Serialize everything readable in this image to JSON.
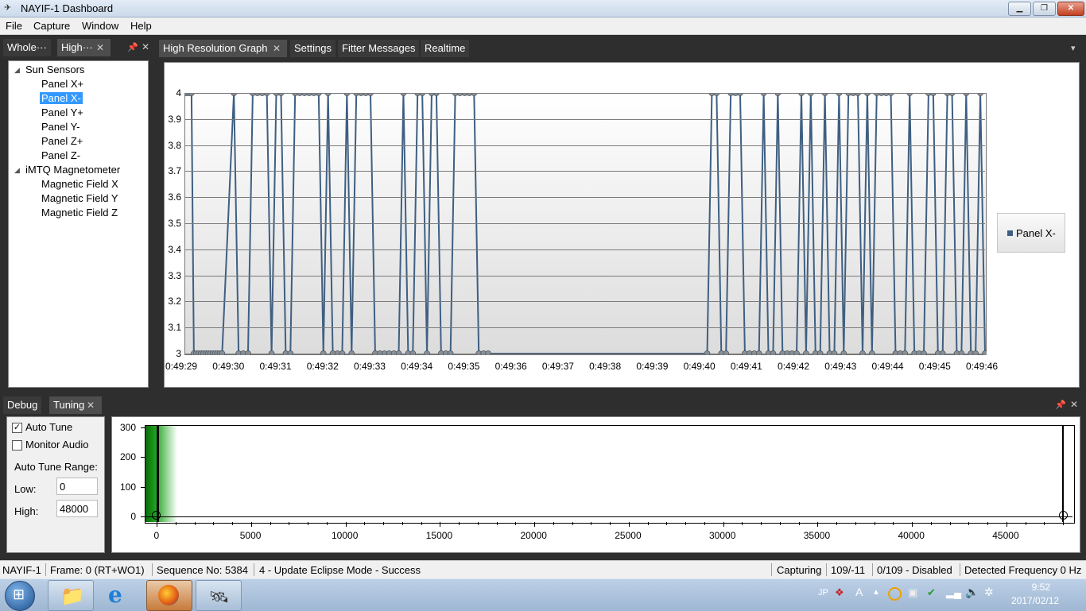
{
  "window": {
    "title": "NAYIF-1 Dashboard"
  },
  "menu": [
    "File",
    "Capture",
    "Window",
    "Help"
  ],
  "left_panel": {
    "tabs": [
      "Whole···",
      "High···"
    ],
    "tree": [
      {
        "label": "Sun Sensors",
        "children": [
          "Panel X+",
          "Panel X-",
          "Panel Y+",
          "Panel Y-",
          "Panel Z+",
          "Panel Z-"
        ]
      },
      {
        "label": "iMTQ Magnetometer",
        "children": [
          "Magnetic Field X",
          "Magnetic Field Y",
          "Magnetic Field Z"
        ]
      }
    ],
    "selected": "Panel X-"
  },
  "main_tabs": [
    "High Resolution Graph",
    "Settings",
    "Fitter Messages",
    "Realtime"
  ],
  "chart_data": {
    "type": "line",
    "series": [
      {
        "name": "Panel X-",
        "color": "#3e5f82"
      }
    ],
    "y_ticks": [
      "4",
      "3.9",
      "3.8",
      "3.7",
      "3.6",
      "3.5",
      "3.4",
      "3.3",
      "3.2",
      "3.1",
      "3"
    ],
    "ylim": [
      3,
      4
    ],
    "x_ticks": [
      "0:49:29",
      "0:49:30",
      "0:49:31",
      "0:49:32",
      "0:49:33",
      "0:49:34",
      "0:49:35",
      "0:49:36",
      "0:49:37",
      "0:49:38",
      "0:49:39",
      "0:49:40",
      "0:49:41",
      "0:49:42",
      "0:49:43",
      "0:49:44",
      "0:49:45",
      "0:49:46"
    ],
    "points": [
      [
        0.0,
        4
      ],
      [
        0.05,
        4
      ],
      [
        0.1,
        4
      ],
      [
        0.15,
        4
      ],
      [
        0.2,
        3
      ],
      [
        0.25,
        3
      ],
      [
        0.3,
        3
      ],
      [
        0.35,
        3
      ],
      [
        0.4,
        3
      ],
      [
        0.45,
        3
      ],
      [
        0.5,
        3
      ],
      [
        0.55,
        3
      ],
      [
        0.6,
        3
      ],
      [
        0.65,
        3
      ],
      [
        0.7,
        3
      ],
      [
        0.75,
        3
      ],
      [
        0.8,
        3
      ],
      [
        1.05,
        4
      ],
      [
        1.15,
        3
      ],
      [
        1.25,
        3
      ],
      [
        1.35,
        3
      ],
      [
        1.45,
        4
      ],
      [
        1.55,
        4
      ],
      [
        1.65,
        4
      ],
      [
        1.75,
        4
      ],
      [
        1.85,
        3
      ],
      [
        1.95,
        4
      ],
      [
        2.05,
        4
      ],
      [
        2.15,
        3
      ],
      [
        2.25,
        3
      ],
      [
        2.35,
        4
      ],
      [
        2.45,
        4
      ],
      [
        2.55,
        4
      ],
      [
        2.65,
        4
      ],
      [
        2.75,
        4
      ],
      [
        2.85,
        4
      ],
      [
        2.95,
        3
      ],
      [
        3.05,
        4
      ],
      [
        3.15,
        3
      ],
      [
        3.25,
        3
      ],
      [
        3.35,
        3
      ],
      [
        3.45,
        4
      ],
      [
        3.55,
        3
      ],
      [
        3.65,
        4
      ],
      [
        3.75,
        4
      ],
      [
        3.85,
        4
      ],
      [
        3.95,
        4
      ],
      [
        4.05,
        3
      ],
      [
        4.15,
        3
      ],
      [
        4.25,
        3
      ],
      [
        4.35,
        3
      ],
      [
        4.45,
        3
      ],
      [
        4.55,
        3
      ],
      [
        4.65,
        4
      ],
      [
        4.75,
        3
      ],
      [
        4.85,
        3
      ],
      [
        4.95,
        4
      ],
      [
        5.05,
        4
      ],
      [
        5.15,
        3
      ],
      [
        5.25,
        4
      ],
      [
        5.35,
        4
      ],
      [
        5.45,
        3
      ],
      [
        5.55,
        3
      ],
      [
        5.65,
        3
      ],
      [
        5.75,
        4
      ],
      [
        5.85,
        4
      ],
      [
        5.95,
        4
      ],
      [
        6.05,
        4
      ],
      [
        6.15,
        4
      ],
      [
        6.25,
        3
      ],
      [
        6.35,
        3
      ],
      [
        6.45,
        3
      ],
      [
        11.1,
        3
      ],
      [
        11.2,
        4
      ],
      [
        11.3,
        4
      ],
      [
        11.4,
        3
      ],
      [
        11.5,
        3
      ],
      [
        11.6,
        4
      ],
      [
        11.7,
        4
      ],
      [
        11.8,
        4
      ],
      [
        11.9,
        3
      ],
      [
        12.0,
        3
      ],
      [
        12.1,
        3
      ],
      [
        12.2,
        3
      ],
      [
        12.3,
        4
      ],
      [
        12.4,
        3
      ],
      [
        12.5,
        3
      ],
      [
        12.6,
        4
      ],
      [
        12.7,
        3
      ],
      [
        12.8,
        3
      ],
      [
        12.9,
        3
      ],
      [
        13.0,
        3
      ],
      [
        13.1,
        4
      ],
      [
        13.2,
        3
      ],
      [
        13.3,
        4
      ],
      [
        13.4,
        3
      ],
      [
        13.5,
        3
      ],
      [
        13.6,
        4
      ],
      [
        13.7,
        3
      ],
      [
        13.8,
        3
      ],
      [
        13.9,
        4
      ],
      [
        14.0,
        3
      ],
      [
        14.1,
        4
      ],
      [
        14.2,
        4
      ],
      [
        14.3,
        4
      ],
      [
        14.4,
        3
      ],
      [
        14.5,
        4
      ],
      [
        14.6,
        3
      ],
      [
        14.7,
        4
      ],
      [
        14.8,
        4
      ],
      [
        14.9,
        4
      ],
      [
        15.0,
        4
      ],
      [
        15.1,
        3
      ],
      [
        15.2,
        3
      ],
      [
        15.3,
        3
      ],
      [
        15.4,
        4
      ],
      [
        15.5,
        3
      ],
      [
        15.6,
        3
      ],
      [
        15.7,
        3
      ],
      [
        15.8,
        4
      ],
      [
        15.9,
        4
      ],
      [
        16.0,
        3
      ],
      [
        16.1,
        3
      ],
      [
        16.2,
        4
      ],
      [
        16.3,
        4
      ],
      [
        16.4,
        3
      ],
      [
        16.5,
        3
      ],
      [
        16.6,
        4
      ],
      [
        16.7,
        3
      ],
      [
        16.8,
        3
      ],
      [
        16.9,
        4
      ],
      [
        17.0,
        3
      ]
    ],
    "x_range": [
      0,
      17
    ],
    "legend": "right"
  },
  "bottom_panel": {
    "tabs": [
      "Debug",
      "Tuning"
    ],
    "auto_tune_label": "Auto Tune",
    "auto_tune_checked": true,
    "monitor_audio_label": "Monitor Audio",
    "monitor_audio_checked": false,
    "range_label": "Auto Tune Range:",
    "low_label": "Low:",
    "low_value": "0",
    "high_label": "High:",
    "high_value": "48000",
    "spectrum": {
      "y_ticks": [
        "300",
        "200",
        "100",
        "0"
      ],
      "x_ticks": [
        "0",
        "5000",
        "10000",
        "15000",
        "20000",
        "25000",
        "30000",
        "35000",
        "40000",
        "45000"
      ],
      "x_max": 48000
    }
  },
  "status": {
    "sat": "NAYIF-1",
    "frame": "Frame:  0 (RT+WO1)",
    "sequence": "Sequence No:  5384",
    "message": "4 - Update Eclipse Mode - Success",
    "capturing": "Capturing",
    "count1": "109/-11",
    "count2": "0/109 - Disabled",
    "freq": "Detected Frequency  0 Hz"
  },
  "taskbar": {
    "lang": "JP",
    "time": "9:52",
    "date": "2017/02/12"
  }
}
